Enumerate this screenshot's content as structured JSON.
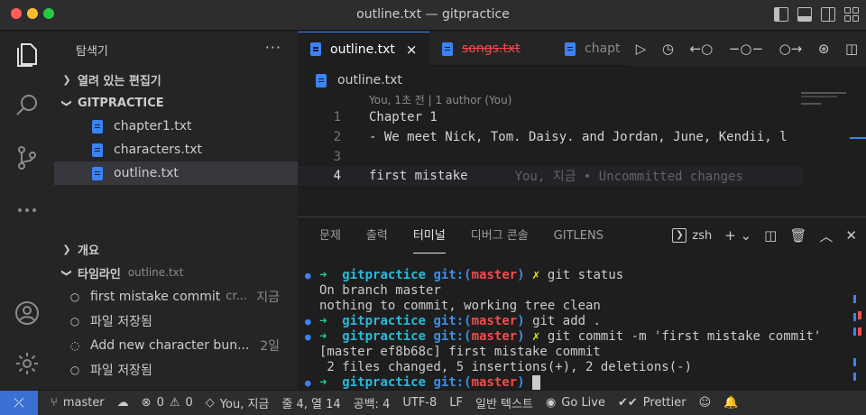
{
  "window": {
    "title": "outline.txt — gitpractice"
  },
  "sidebar": {
    "title": "탐색기",
    "more": "···",
    "open_editors": "열려 있는 편집기",
    "folder": "GITPRACTICE",
    "files": [
      "chapter1.txt",
      "characters.txt",
      "outline.txt"
    ],
    "outline_section": "개요",
    "timeline_section": "타임라인",
    "timeline_file": "outline.txt",
    "timeline": [
      {
        "label": "first mistake commit",
        "desc": "cr...",
        "time": "지금"
      },
      {
        "label": "파일 저장됨",
        "desc": "",
        "time": ""
      },
      {
        "label": "Add new character bun...",
        "desc": "",
        "time": "2일"
      },
      {
        "label": "파일 저장됨",
        "desc": "",
        "time": ""
      }
    ]
  },
  "tabs": [
    {
      "label": "outline.txt",
      "close": "×"
    },
    {
      "label": "songs.txt"
    },
    {
      "label": "chapt"
    }
  ],
  "breadcrumb": "outline.txt",
  "editor": {
    "blame_header": "You, 1초 전 | 1 author (You)",
    "lines": [
      {
        "n": "1",
        "text": "Chapter 1"
      },
      {
        "n": "2",
        "text": "- We meet Nick, Tom. Daisy. and Jordan, June, Kendii, l"
      },
      {
        "n": "3",
        "text": ""
      },
      {
        "n": "4",
        "text": "first mistake",
        "blame": "You, 지금 • Uncommitted changes"
      }
    ]
  },
  "panel": {
    "tabs": [
      "문제",
      "출력",
      "터미널",
      "디버그 콘솔",
      "GITLENS"
    ],
    "shell": "zsh",
    "terminal": [
      {
        "type": "prompt",
        "dir": "gitpractice",
        "branch": "master",
        "cmd": "git status"
      },
      {
        "type": "out",
        "text": "On branch master"
      },
      {
        "type": "out",
        "text": "nothing to commit, working tree clean"
      },
      {
        "type": "prompt",
        "dir": "gitpractice",
        "branch": "master",
        "cmd": "git add ."
      },
      {
        "type": "prompt",
        "dir": "gitpractice",
        "branch": "master",
        "cmd": "git commit -m 'first mistake commit'"
      },
      {
        "type": "out",
        "text": "[master ef8b68c] first mistake commit"
      },
      {
        "type": "out",
        "text": " 2 files changed, 5 insertions(+), 2 deletions(-)"
      },
      {
        "type": "prompt",
        "dir": "gitpractice",
        "branch": "master",
        "cmd": ""
      }
    ]
  },
  "status": {
    "branch": "master",
    "errors": "0",
    "warnings": "0",
    "blame": "You, 지금",
    "position": "줄 4, 열 14",
    "spaces": "공백: 4",
    "encoding": "UTF-8",
    "eol": "LF",
    "language": "일반 텍스트",
    "golive": "Go Live",
    "prettier": "Prettier"
  },
  "colors": {
    "accent": "#3b82f6",
    "deleted": "#f14c4c",
    "remote": "#3b6fd1"
  }
}
